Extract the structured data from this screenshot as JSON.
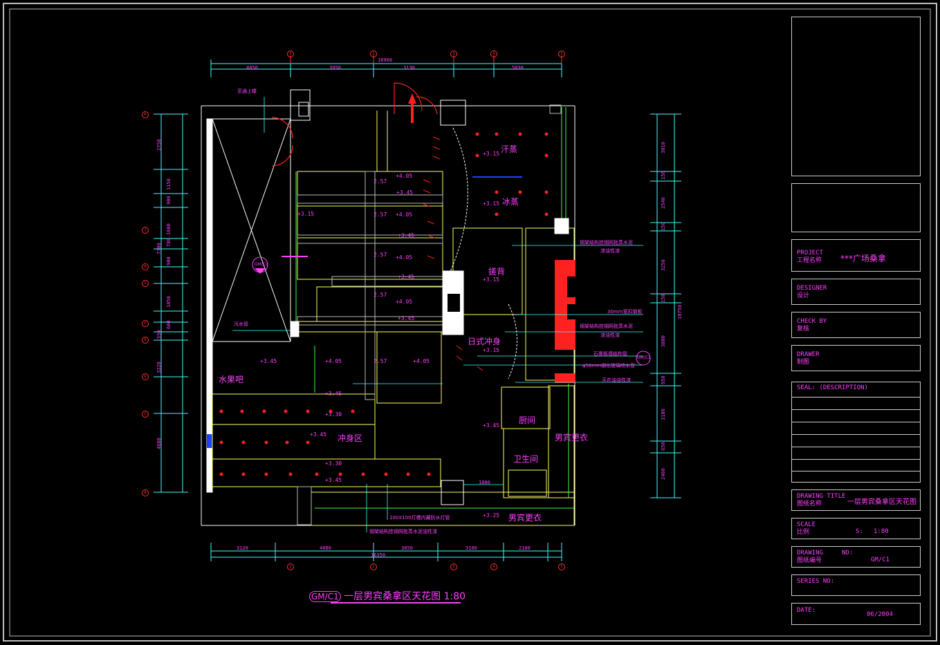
{
  "drawing": {
    "title": "一层男宾桑拿区天花图 1:80",
    "title_code": "GM/C1",
    "callout_code": "GM/C1"
  },
  "rooms": {
    "sauna_dry": "汗蒸",
    "sauna_steam": "冰蒸",
    "spa_bath": "搓背",
    "japanese_shower": "日式冲身",
    "fruit_bar": "水果吧",
    "shower_area": "冲身区",
    "kitchen": "厨间",
    "restroom": "卫生间",
    "mens_locker": "男宾更衣",
    "mens_locker_2": "男宾更衣"
  },
  "levels": [
    "+3.15",
    "+3.15",
    "+4.05",
    "+3.45",
    "+3.15",
    "+4.05",
    "+3.45",
    "+4.05",
    "+3.45",
    "+4.05",
    "+3.45",
    "+3.15",
    "+3.45",
    "+4.05",
    "+4.05",
    "+3.15",
    "+3.45",
    "+3.30",
    "+3.45",
    "+3.45",
    "+3.30",
    "+3.45",
    "+3.25",
    "2.57",
    "2.57",
    "2.57",
    "2.57",
    "2.57"
  ],
  "notes": {
    "up_stair": "至通上楼",
    "sewage_pipe": "污水管",
    "steel_frame_1": "钢架结构挂钢网批蒸水泥",
    "steel_frame_1b": "漆油性漆",
    "plaster_board": "30mm宽扣钢板",
    "steel_frame_2": "钢架结构挂钢网批蒸水泥",
    "steel_frame_2b": "漆油性漆",
    "stone_wall": "石膏板墙结构管",
    "glass_pipe": "φ50mm钢化玻璃喷水管",
    "painted_wood": "天花油油性漆",
    "light_trough": "100X100灯槽内藏防水灯管",
    "steel_frame_3": "钢架结构挂钢网批蒸水泥油性漆",
    "door_dim": "1000"
  },
  "dimensions": {
    "top_overall": "16960",
    "top": [
      "4050",
      "3950",
      "3130",
      "5830"
    ],
    "bottom_overall": "16350",
    "bottom": [
      "3120",
      "4080",
      "3050",
      "3100",
      "2100"
    ],
    "left": [
      "2750",
      "1150",
      "900",
      "1600",
      "780",
      "900",
      "1050",
      "600",
      "550",
      "3220",
      "4600",
      "7700"
    ],
    "right": [
      "3010",
      "150",
      "2540",
      "150",
      "3250",
      "150",
      "3800",
      "950",
      "3180",
      "650",
      "2460",
      "18750"
    ]
  },
  "grid_axes": {
    "top": [
      "3",
      "2",
      "3",
      "4",
      "5"
    ],
    "bottom": [
      "1",
      "2",
      "3",
      "4",
      "5"
    ],
    "left": [
      "K",
      "J",
      "H",
      "G",
      "F",
      "E",
      "D",
      "C",
      "B"
    ]
  },
  "title_block": {
    "project_label": "PROJECT",
    "project_label_cn": "工程名称",
    "project_value": "***广场桑拿",
    "designer_label": "DESIGNER",
    "designer_label_cn": "设计",
    "check_label": "CHECK BY",
    "check_label_cn": "复核",
    "drawer_label": "DRAWER",
    "drawer_label_cn": "制图",
    "seal_label": "SEAL: (DESCRIPTION)",
    "title_label": "DRAWING TITLE",
    "title_label_cn": "图纸名称",
    "title_value": "一层男宾桑拿区天花图",
    "scale_label": "SCALE",
    "scale_label_cn": "比例",
    "scale_prefix": "S:",
    "scale_value": "1:80",
    "number_label": "DRAWING",
    "number_label_2": "NO:",
    "number_label_cn": "图纸编号",
    "number_value": "GM/C1",
    "series_label": "SERIES NO:",
    "date_label": "DATE:",
    "date_value": "06/2004"
  },
  "colors": {
    "background": "#000000",
    "wall_white": "#ffffff",
    "partition_yellow": "#ffff60",
    "dimension_cyan": "#40ffff",
    "text_magenta": "#ff40ff",
    "light_red": "#ff2020",
    "accent_green": "#40ff40",
    "pipe_blue": "#2040ff"
  }
}
